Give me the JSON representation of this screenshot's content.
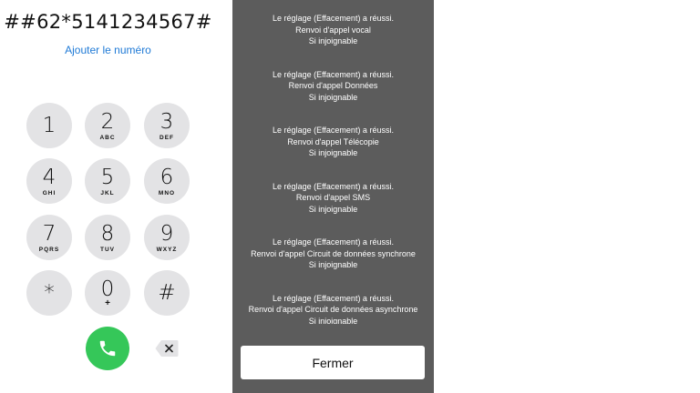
{
  "dialer": {
    "number": "##62*5141234567#",
    "add_number_label": "Ajouter le numéro",
    "keys": [
      {
        "digit": "1",
        "letters": ""
      },
      {
        "digit": "2",
        "letters": "ABC"
      },
      {
        "digit": "3",
        "letters": "DEF"
      },
      {
        "digit": "4",
        "letters": "GHI"
      },
      {
        "digit": "5",
        "letters": "JKL"
      },
      {
        "digit": "6",
        "letters": "MNO"
      },
      {
        "digit": "7",
        "letters": "PQRS"
      },
      {
        "digit": "8",
        "letters": "TUV"
      },
      {
        "digit": "9",
        "letters": "WXYZ"
      },
      {
        "digit": "*",
        "letters": ""
      },
      {
        "digit": "0",
        "letters": "+"
      },
      {
        "digit": "#",
        "letters": ""
      }
    ],
    "call_icon": "phone-icon",
    "delete_icon": "delete-backspace-icon",
    "call_color": "#35c759"
  },
  "sheet": {
    "messages": [
      {
        "line1": "Le réglage (Effacement) a réussi.",
        "line2": "Renvoi d'appel vocal",
        "line3": "Si injoignable"
      },
      {
        "line1": "Le réglage (Effacement) a réussi.",
        "line2": "Renvoi d'appel Données",
        "line3": "Si injoignable"
      },
      {
        "line1": "Le réglage (Effacement) a réussi.",
        "line2": "Renvoi d'appel Télécopie",
        "line3": "Si injoignable"
      },
      {
        "line1": "Le réglage (Effacement) a réussi.",
        "line2": "Renvoi d'appel SMS",
        "line3": "Si injoignable"
      },
      {
        "line1": "Le réglage (Effacement) a réussi.",
        "line2": "Renvoi d'appel Circuit de données synchrone",
        "line3": "Si injoignable"
      },
      {
        "line1": "Le réglage (Effacement) a réussi.",
        "line2": "Renvoi d'appel Circuit de données asynchrone",
        "line3": "Si injoignable"
      }
    ],
    "close_label": "Fermer",
    "background_color": "#5c5c5c"
  }
}
